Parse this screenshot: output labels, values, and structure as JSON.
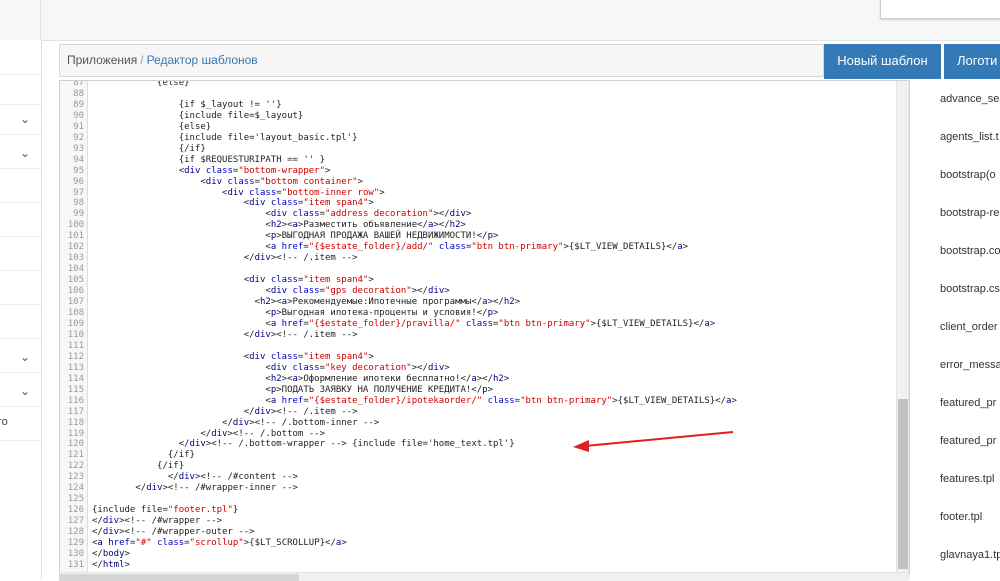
{
  "breadcrumb": {
    "root": "Приложения",
    "separator": "/",
    "current": "Редактор шаблонов"
  },
  "buttons": {
    "new_template": "Новый шаблон",
    "logos": "Логоти"
  },
  "left_nav": {
    "partial_text": "ro"
  },
  "editor": {
    "lines": [
      {
        "n": "87",
        "code": "            {else}"
      },
      {
        "n": "88",
        "code": ""
      },
      {
        "n": "89",
        "code": "                {if $_layout != ''}"
      },
      {
        "n": "90",
        "code": "                {include file=$_layout}"
      },
      {
        "n": "91",
        "code": "                {else}"
      },
      {
        "n": "92",
        "code": "                {include file='layout_basic.tpl'}"
      },
      {
        "n": "93",
        "code": "                {/if}"
      },
      {
        "n": "94",
        "code": "                {if $REQUESTURIPATH == '' }"
      },
      {
        "n": "95",
        "code": "                <div class=\"bottom-wrapper\">"
      },
      {
        "n": "96",
        "code": "                    <div class=\"bottom container\">"
      },
      {
        "n": "97",
        "code": "                        <div class=\"bottom-inner row\">"
      },
      {
        "n": "98",
        "code": "                            <div class=\"item span4\">"
      },
      {
        "n": "99",
        "code": "                                <div class=\"address decoration\"></div>"
      },
      {
        "n": "100",
        "code": "                                <h2><a>Разместить объявление</a></h2>"
      },
      {
        "n": "101",
        "code": "                                <p>ВЫГОДНАЯ ПРОДАЖА ВАШЕЙ НЕДВИЖИМОСТИ!</p>"
      },
      {
        "n": "102",
        "code": "                                <a href=\"{$estate_folder}/add/\" class=\"btn btn-primary\">{$LT_VIEW_DETAILS}</a>"
      },
      {
        "n": "103",
        "code": "                            </div><!-- /.item -->"
      },
      {
        "n": "104",
        "code": ""
      },
      {
        "n": "105",
        "code": "                            <div class=\"item span4\">"
      },
      {
        "n": "106",
        "code": "                                <div class=\"gps decoration\"></div>"
      },
      {
        "n": "107",
        "code": "                              <h2><a>Рекомендуемые:Ипотечные программы</a></h2>"
      },
      {
        "n": "108",
        "code": "                                <p>Выгодная ипотека-проценты и условия!</p>"
      },
      {
        "n": "109",
        "code": "                                <a href=\"{$estate_folder}/pravilla/\" class=\"btn btn-primary\">{$LT_VIEW_DETAILS}</a>"
      },
      {
        "n": "110",
        "code": "                            </div><!-- /.item -->"
      },
      {
        "n": "111",
        "code": ""
      },
      {
        "n": "112",
        "code": "                            <div class=\"item span4\">"
      },
      {
        "n": "113",
        "code": "                                <div class=\"key decoration\"></div>"
      },
      {
        "n": "114",
        "code": "                                <h2><a>Оформление ипотеки бесплатно!</a></h2>"
      },
      {
        "n": "115",
        "code": "                                <p>ПОДАТЬ ЗАЯВКУ НА ПОЛУЧЕНИЕ КРЕДИТА!</p>"
      },
      {
        "n": "116",
        "code": "                                <a href=\"{$estate_folder}/ipotekaorder/\" class=\"btn btn-primary\">{$LT_VIEW_DETAILS}</a>"
      },
      {
        "n": "117",
        "code": "                            </div><!-- /.item -->"
      },
      {
        "n": "118",
        "code": "                        </div><!-- /.bottom-inner -->"
      },
      {
        "n": "119",
        "code": "                    </div><!-- /.bottom -->"
      },
      {
        "n": "120",
        "code": "                </div><!-- /.bottom-wrapper --> {include file='home_text.tpl'}"
      },
      {
        "n": "121",
        "code": "              {/if}"
      },
      {
        "n": "122",
        "code": "            {/if}"
      },
      {
        "n": "123",
        "code": "              </div><!-- /#content -->"
      },
      {
        "n": "124",
        "code": "        </div><!-- /#wrapper-inner -->"
      },
      {
        "n": "125",
        "code": ""
      },
      {
        "n": "126",
        "code": "{include file=\"footer.tpl\"}"
      },
      {
        "n": "127",
        "code": "</div><!-- /#wrapper -->"
      },
      {
        "n": "128",
        "code": "</div><!-- /#wrapper-outer -->"
      },
      {
        "n": "129",
        "code": "<a href=\"#\" class=\"scrollup\">{$LT_SCROLLUP}</a>"
      },
      {
        "n": "130",
        "code": "</body>"
      },
      {
        "n": "131",
        "code": "</html>"
      }
    ]
  },
  "files": [
    "advance_sea",
    "agents_list.t",
    "bootstrap(o",
    "bootstrap-re",
    "bootstrap.co",
    "bootstrap.cs",
    "client_order",
    "error_messa",
    "featured_pr",
    "featured_pr",
    "features.tpl",
    "footer.tpl",
    "glavnaya1.tp"
  ],
  "colors": {
    "accent": "#337ab7",
    "arrow": "#e02020",
    "tag": "#000080",
    "attr": "#0000cc",
    "string": "#cc0000"
  },
  "icons": {
    "nav_expand": "chevron-down-icon"
  }
}
